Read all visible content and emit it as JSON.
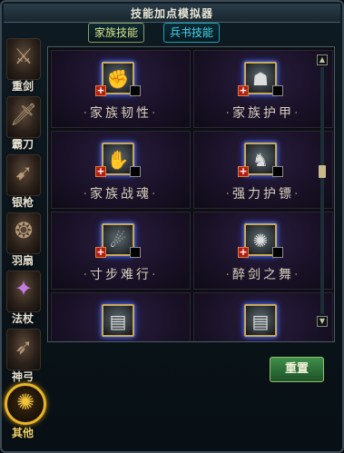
{
  "window": {
    "title": "技能加点模拟器"
  },
  "tabs": [
    {
      "label": "家族技能",
      "active": true
    },
    {
      "label": "兵书技能",
      "active": false
    }
  ],
  "sidebar": {
    "items": [
      {
        "label": "重剑",
        "icon": "greatsword-icon",
        "active": false
      },
      {
        "label": "霸刀",
        "icon": "saber-icon",
        "active": false
      },
      {
        "label": "银枪",
        "icon": "spear-icon",
        "active": false
      },
      {
        "label": "羽扇",
        "icon": "fan-icon",
        "active": false
      },
      {
        "label": "法杖",
        "icon": "staff-icon",
        "active": false
      },
      {
        "label": "神弓",
        "icon": "bow-icon",
        "active": false
      },
      {
        "label": "其他",
        "icon": "other-emblem-icon",
        "active": true
      }
    ]
  },
  "skills": [
    {
      "name": "家族韧性",
      "icon": "tenacity-icon"
    },
    {
      "name": "家族护甲",
      "icon": "armor-icon"
    },
    {
      "name": "家族战魂",
      "icon": "war-spirit-icon"
    },
    {
      "name": "强力护镖",
      "icon": "escort-icon"
    },
    {
      "name": "寸步难行",
      "icon": "immobile-icon"
    },
    {
      "name": "醉剑之舞",
      "icon": "sword-dance-icon"
    },
    {
      "name": "",
      "icon": "book-icon"
    },
    {
      "name": "",
      "icon": "book-icon"
    }
  ],
  "skill_add_icon": "plus-icon",
  "buttons": {
    "reset_label": "重置"
  },
  "colors": {
    "active_tab_text": "#d8e28a",
    "inactive_tab_text": "#3fd7ee",
    "skill_cell_bg": "#1a1228",
    "reset_button": "#2c6d37",
    "active_category_ring": "#e8b526"
  }
}
